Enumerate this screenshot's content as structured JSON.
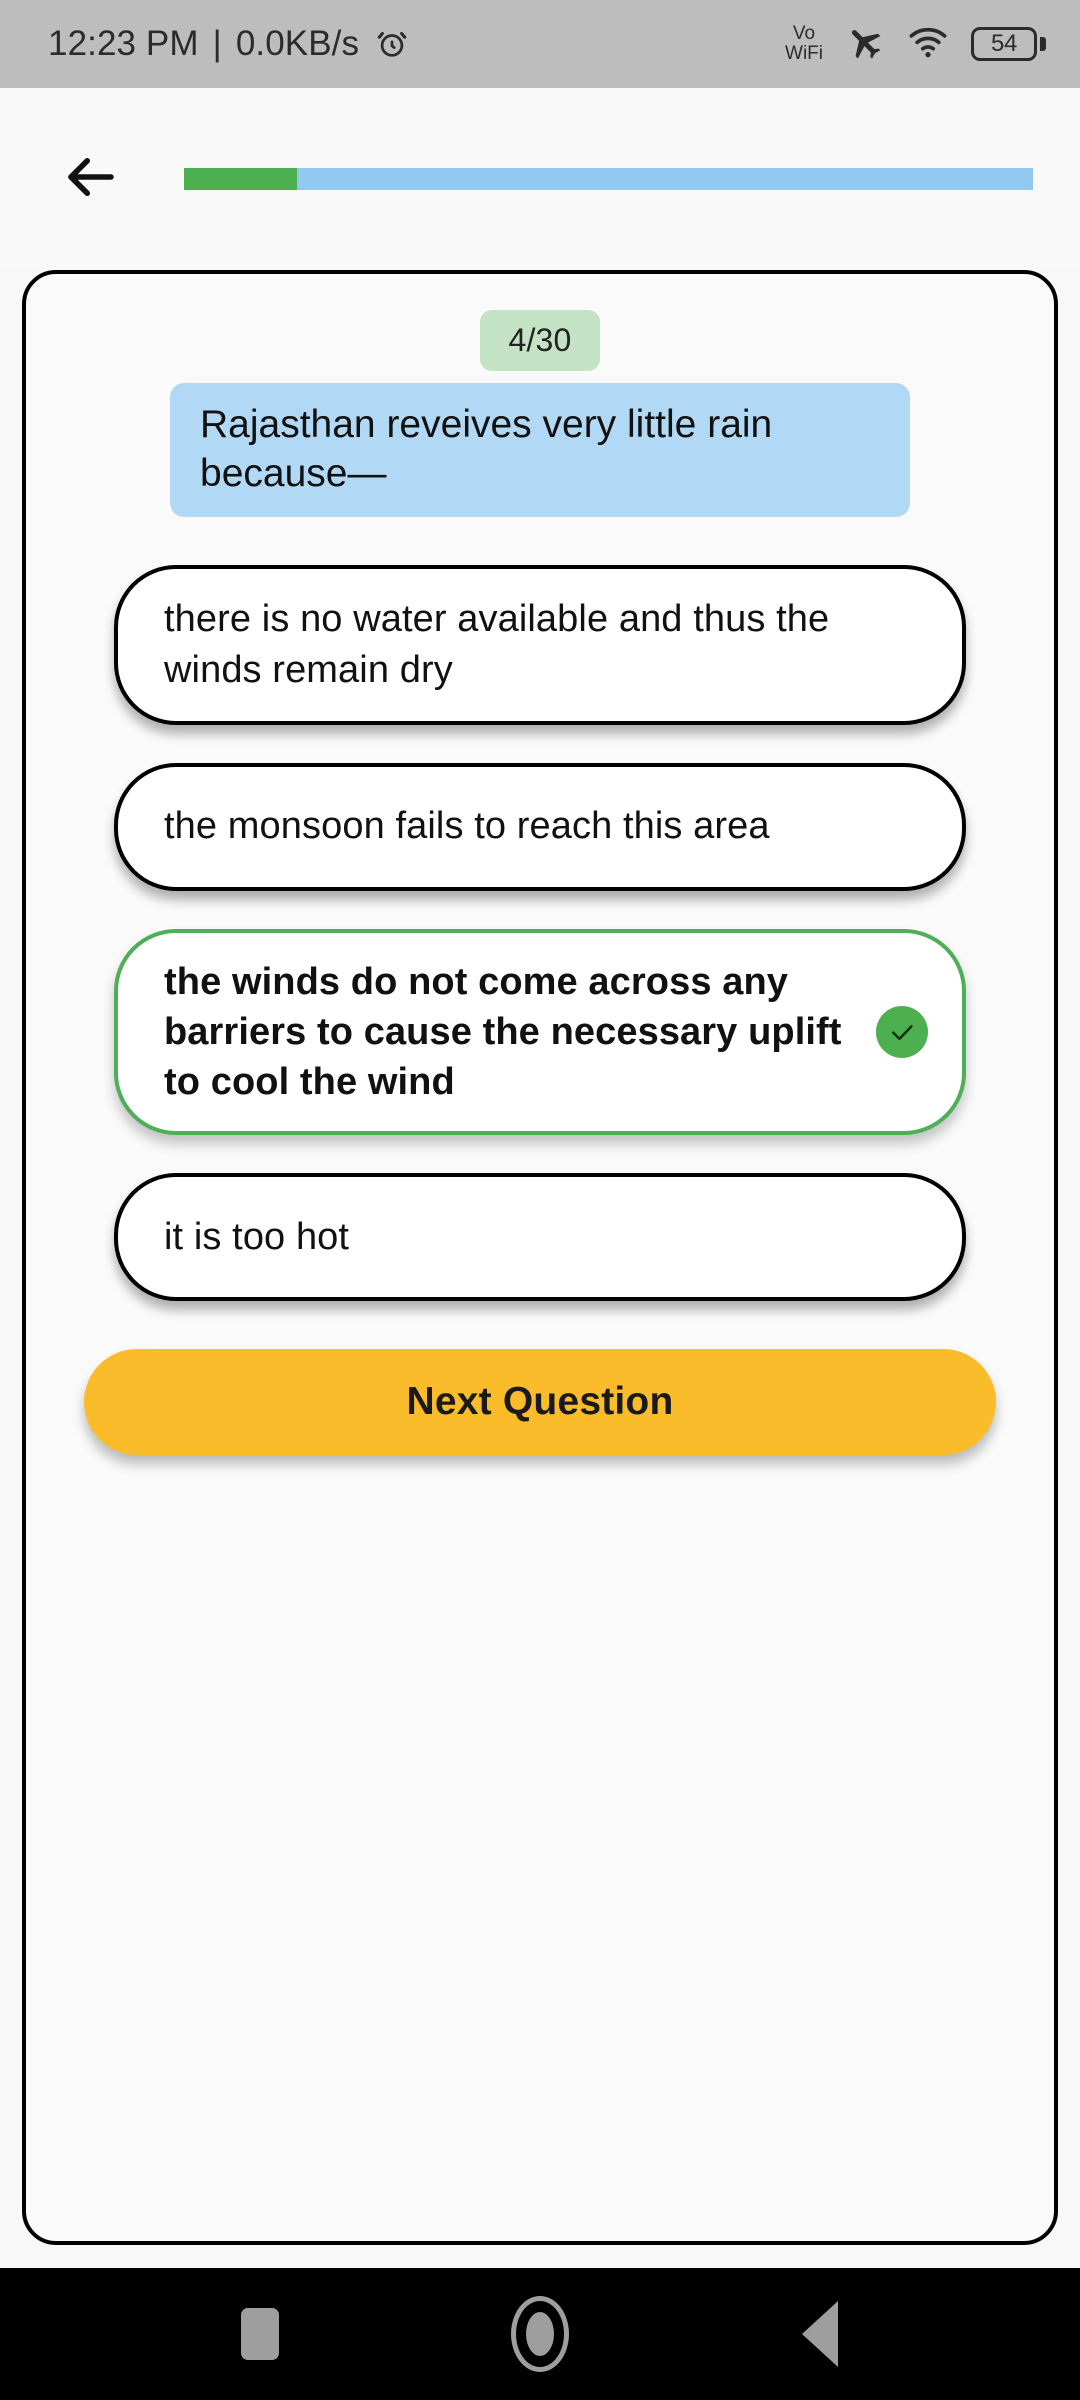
{
  "status_bar": {
    "time": "12:23 PM",
    "separator": "|",
    "network_speed": "0.0KB/s",
    "alarm_icon": "alarm-clock-icon",
    "vowifi_line1": "Vo",
    "vowifi_line2": "WiFi",
    "airplane_icon": "airplane-mode-icon",
    "wifi_icon": "wifi-icon",
    "battery_level": "54",
    "background": "#bdbdbd"
  },
  "app_bar": {
    "back_icon": "arrow-left-icon",
    "progress": {
      "value": 4,
      "max": 30,
      "percent": 13.3,
      "fill_color": "#4caf50",
      "track_color": "#92c9f0"
    }
  },
  "quiz": {
    "counter_badge": "4/30",
    "counter_badge_color": "#c4e3c4",
    "question": "Rajasthan reveives very little rain because—",
    "question_bubble_color": "#b1d8f5",
    "options": [
      {
        "label": "there is no water available and thus the winds remain dry",
        "state": "default",
        "border_color": "#000000"
      },
      {
        "label": "the monsoon fails to reach this area",
        "state": "default",
        "border_color": "#000000"
      },
      {
        "label": "the winds do not come across any barriers to cause the necessary uplift to cool the wind",
        "state": "correct",
        "border_color": "#4fae58",
        "check_icon": "check-icon",
        "check_badge_color": "#4caf50"
      },
      {
        "label": "it is too hot",
        "state": "default",
        "border_color": "#000000"
      }
    ],
    "next_button": "Next Question",
    "next_button_color": "#fabc2a"
  },
  "nav_bar": {
    "recents_icon": "square-recents-icon",
    "home_icon": "circle-home-icon",
    "back_icon": "triangle-back-icon",
    "background": "#000000",
    "icon_color": "#9e9e9e"
  }
}
